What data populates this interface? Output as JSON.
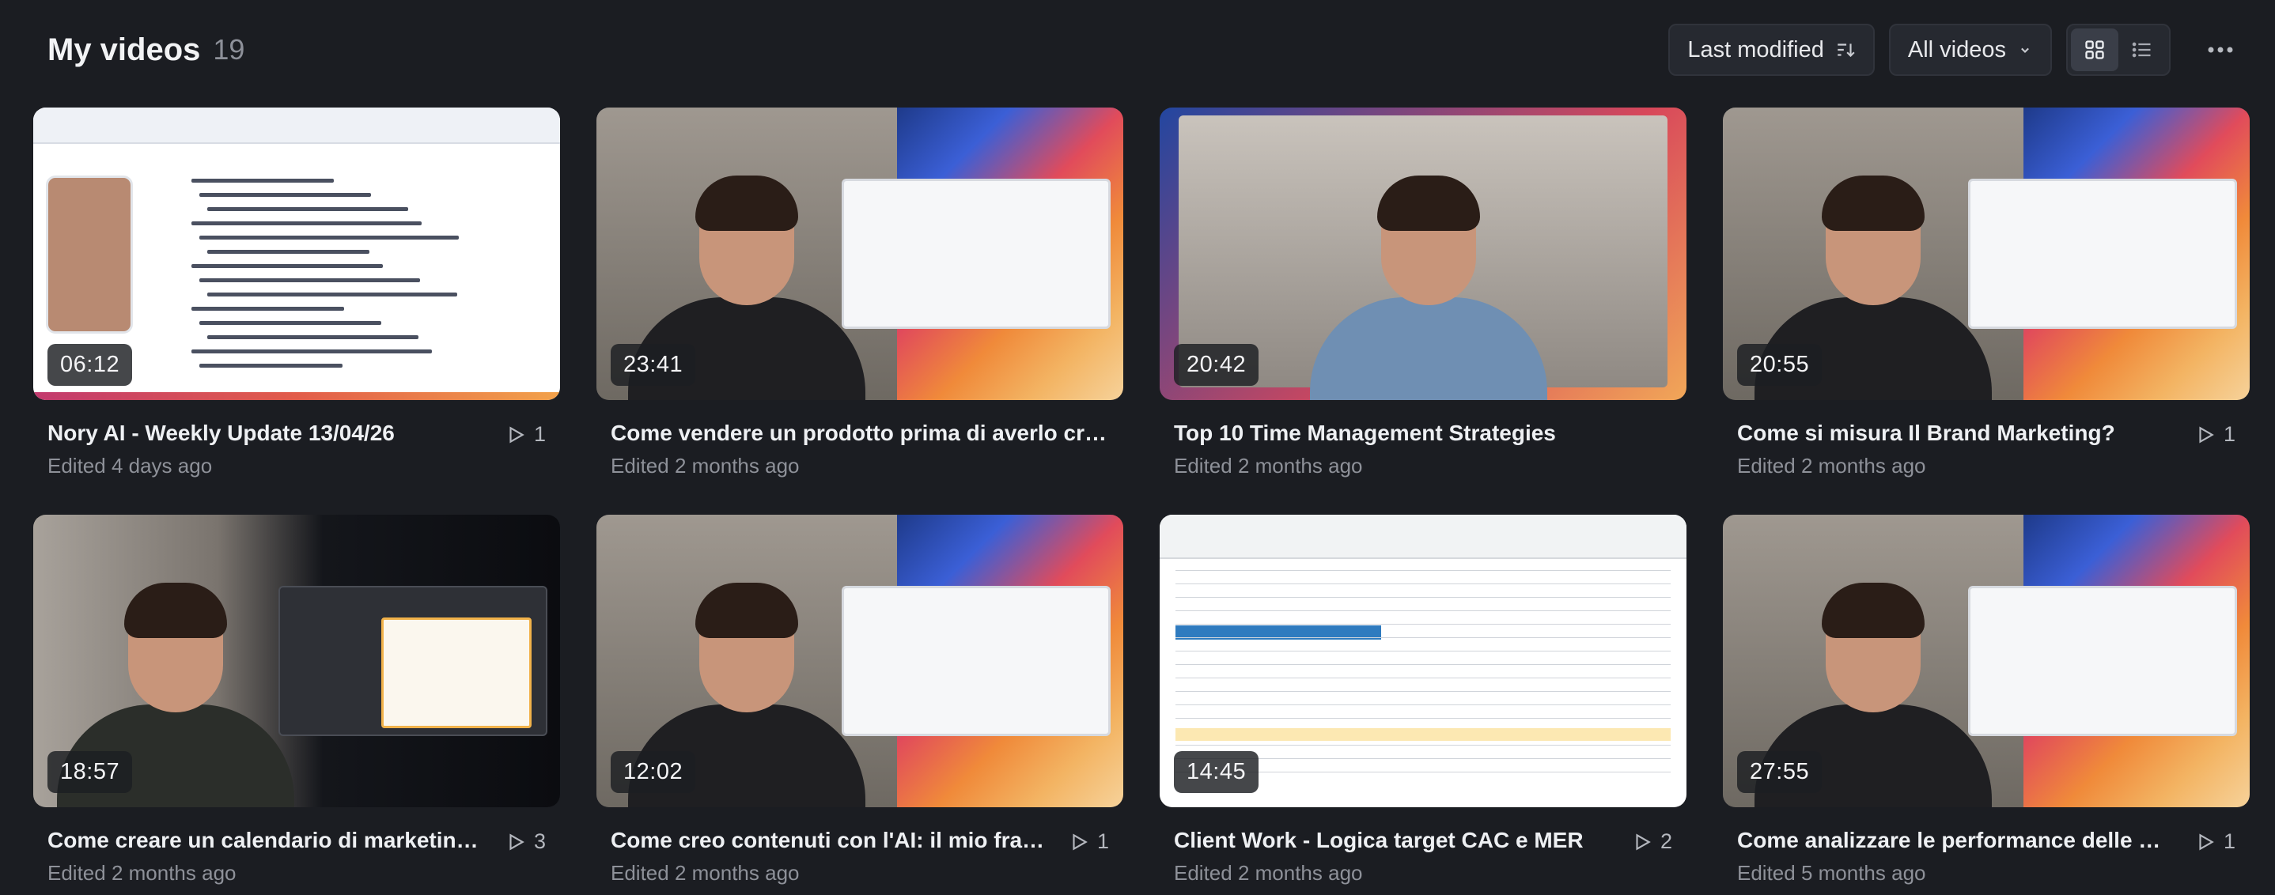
{
  "header": {
    "title": "My videos",
    "count": "19",
    "sort_label": "Last modified",
    "filter_label": "All videos"
  },
  "colors": {
    "background": "#1b1d22",
    "control_bg": "#262930",
    "muted_text": "#8e9199"
  },
  "icons": {
    "sort": "sort-descending-icon",
    "filter": "chevron-down-icon",
    "grid_view": "grid-view-icon",
    "list_view": "list-view-icon",
    "more": "more-horizontal-icon",
    "views": "play-outline-icon"
  },
  "videos": [
    {
      "title": "Nory AI - Weekly Update 13/04/26",
      "edited": "Edited 4 days ago",
      "duration": "06:12",
      "views": "1",
      "thumb": "doc"
    },
    {
      "title": "Come vendere un prodotto prima di averlo cr…",
      "edited": "Edited 2 months ago",
      "duration": "23:41",
      "views": "",
      "thumb": "split"
    },
    {
      "title": "Top 10 Time Management Strategies",
      "edited": "Edited 2 months ago",
      "duration": "20:42",
      "views": "",
      "thumb": "room"
    },
    {
      "title": "Come si misura Il Brand Marketing?",
      "edited": "Edited 2 months ago",
      "duration": "20:55",
      "views": "1",
      "thumb": "split"
    },
    {
      "title": "Come creare un calendario di marketin…",
      "edited": "Edited 2 months ago",
      "duration": "18:57",
      "views": "3",
      "thumb": "dark"
    },
    {
      "title": "Come creo contenuti con l'AI: il mio fra…",
      "edited": "Edited 2 months ago",
      "duration": "12:02",
      "views": "1",
      "thumb": "split"
    },
    {
      "title": "Client Work - Logica target CAC e MER",
      "edited": "Edited 2 months ago",
      "duration": "14:45",
      "views": "2",
      "thumb": "sheet"
    },
    {
      "title": "Come analizzare le performance delle …",
      "edited": "Edited 5 months ago",
      "duration": "27:55",
      "views": "1",
      "thumb": "split"
    }
  ]
}
